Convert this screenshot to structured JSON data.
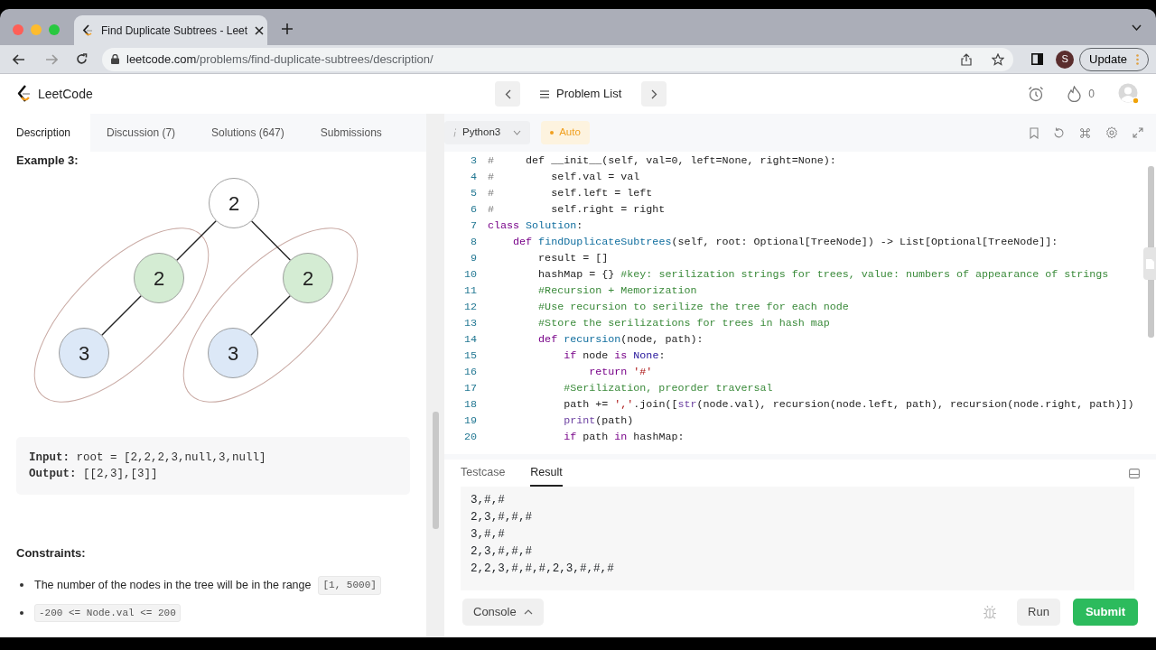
{
  "browser": {
    "tab_title": "Find Duplicate Subtrees - Leet",
    "url_host": "leetcode.com",
    "url_path": "/problems/find-duplicate-subtrees/description/",
    "profile": "S",
    "update_button": "Update"
  },
  "header": {
    "logo_text": "LeetCode",
    "problem_list": "Problem List",
    "streak": "0"
  },
  "left_tabs": [
    {
      "label": "Description",
      "selected": true
    },
    {
      "label": "Discussion (7)",
      "selected": false
    },
    {
      "label": "Solutions (647)",
      "selected": false
    },
    {
      "label": "Submissions",
      "selected": false
    }
  ],
  "example": {
    "heading": "Example 3:",
    "tree": {
      "value": "2",
      "color": "#ffffff",
      "left": {
        "value": "2",
        "color": "#d4ecd3",
        "circled": true,
        "left": {
          "value": "3",
          "color": "#dce8f7"
        }
      },
      "right": {
        "value": "2",
        "color": "#d4ecd3",
        "circled": true,
        "left": {
          "value": "3",
          "color": "#dce8f7"
        }
      }
    },
    "io_lines": [
      "**Input:** root = [2,2,2,3,null,3,null]",
      "**Output:** [[2,3],[3]]"
    ]
  },
  "constraints": {
    "heading": "Constraints:",
    "items": [
      [
        {
          "text": "The number of the nodes in the tree will be in the range ",
          "kind": "text"
        },
        {
          "text": "[1, 5000]",
          "kind": "code"
        }
      ],
      [
        {
          "text": "-200 <= Node.val <= 200",
          "kind": "code"
        }
      ]
    ]
  },
  "editor": {
    "language": "Python3",
    "mode": "Auto",
    "lines": [
      {
        "number": "3",
        "tokens": [
          {
            "text": "#",
            "kind": "mark"
          },
          {
            "text": "     def __init__(self, val=0, left=None, right=None):",
            "kind": "plain"
          }
        ]
      },
      {
        "number": "4",
        "tokens": [
          {
            "text": "#",
            "kind": "mark"
          },
          {
            "text": "         self.val = val",
            "kind": "plain"
          }
        ]
      },
      {
        "number": "5",
        "tokens": [
          {
            "text": "#",
            "kind": "mark"
          },
          {
            "text": "         self.left = left",
            "kind": "plain"
          }
        ]
      },
      {
        "number": "6",
        "tokens": [
          {
            "text": "#",
            "kind": "mark"
          },
          {
            "text": "         self.right = right",
            "kind": "plain"
          }
        ]
      },
      {
        "number": "7",
        "tokens": [
          {
            "text": "class",
            "kind": "keyword"
          },
          {
            "text": " Solution",
            "kind": "name"
          },
          {
            "text": ":",
            "kind": "plain"
          }
        ]
      },
      {
        "number": "8",
        "tokens": [
          {
            "text": "    def",
            "kind": "keyword"
          },
          {
            "text": " findDuplicateSubtrees",
            "kind": "name"
          },
          {
            "text": "(self, root: Optional[TreeNode]) -> List[Optional[TreeNode]]:",
            "kind": "plain"
          }
        ]
      },
      {
        "number": "9",
        "tokens": [
          {
            "text": "        result = []",
            "kind": "plain"
          }
        ]
      },
      {
        "number": "10",
        "tokens": [
          {
            "text": "        hashMap = {} ",
            "kind": "plain"
          },
          {
            "text": "#key: serilization strings for trees, value: numbers of appearance of strings",
            "kind": "comment"
          }
        ]
      },
      {
        "number": "11",
        "tokens": [
          {
            "text": "        #Recursion + Memorization",
            "kind": "comment"
          }
        ]
      },
      {
        "number": "12",
        "tokens": [
          {
            "text": "        #Use recursion to serilize the tree for each node",
            "kind": "comment"
          }
        ]
      },
      {
        "number": "13",
        "tokens": [
          {
            "text": "        #Store the serilizations for trees in hash map",
            "kind": "comment"
          }
        ]
      },
      {
        "number": "14",
        "tokens": [
          {
            "text": "        def",
            "kind": "keyword"
          },
          {
            "text": " recursion",
            "kind": "name"
          },
          {
            "text": "(node, path):",
            "kind": "plain"
          }
        ]
      },
      {
        "number": "15",
        "tokens": [
          {
            "text": "            if",
            "kind": "keyword"
          },
          {
            "text": " node ",
            "kind": "plain"
          },
          {
            "text": "is",
            "kind": "keyword"
          },
          {
            "text": " None",
            "kind": "atom"
          },
          {
            "text": ":",
            "kind": "plain"
          }
        ]
      },
      {
        "number": "16",
        "tokens": [
          {
            "text": "                return",
            "kind": "keyword"
          },
          {
            "text": " '#'",
            "kind": "string"
          }
        ]
      },
      {
        "number": "17",
        "tokens": [
          {
            "text": "            #Serilization, preorder traversal",
            "kind": "comment"
          }
        ]
      },
      {
        "number": "18",
        "tokens": [
          {
            "text": "            path += ",
            "kind": "plain"
          },
          {
            "text": "','",
            "kind": "string"
          },
          {
            "text": ".join([",
            "kind": "plain"
          },
          {
            "text": "str",
            "kind": "builtin"
          },
          {
            "text": "(node.val), recursion(node.left, path), recursion(node.right, path)])",
            "kind": "plain"
          }
        ]
      },
      {
        "number": "19",
        "tokens": [
          {
            "text": "            print",
            "kind": "builtin"
          },
          {
            "text": "(path)",
            "kind": "plain"
          }
        ]
      },
      {
        "number": "20",
        "tokens": [
          {
            "text": "            if",
            "kind": "keyword"
          },
          {
            "text": " path ",
            "kind": "plain"
          },
          {
            "text": "in",
            "kind": "keyword"
          },
          {
            "text": " hashMap:",
            "kind": "plain"
          }
        ]
      }
    ]
  },
  "result_tabs": [
    {
      "label": "Testcase",
      "selected": false
    },
    {
      "label": "Result",
      "selected": true
    }
  ],
  "output_lines": [
    "3,#,#",
    "2,3,#,#,#",
    "3,#,#",
    "2,3,#,#,#",
    "2,2,3,#,#,#,2,3,#,#,#"
  ],
  "footer": {
    "console": "Console",
    "run": "Run",
    "submit": "Submit"
  }
}
